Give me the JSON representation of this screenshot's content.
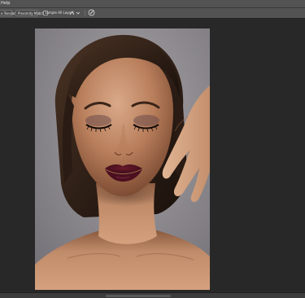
{
  "menubar": {
    "items": [
      "Help"
    ]
  },
  "options": {
    "button1": "e Tension",
    "button2": "Proximity Match",
    "sample_label": "Sample All Layers",
    "icon": "pressure-icon",
    "brush_icon": "brush-settings-icon"
  },
  "document": {
    "image_alt": "portrait-photo"
  },
  "colors": {
    "chrome": "#535353",
    "canvas_bg": "#282828",
    "photo_bg": "#8d8b8d"
  }
}
